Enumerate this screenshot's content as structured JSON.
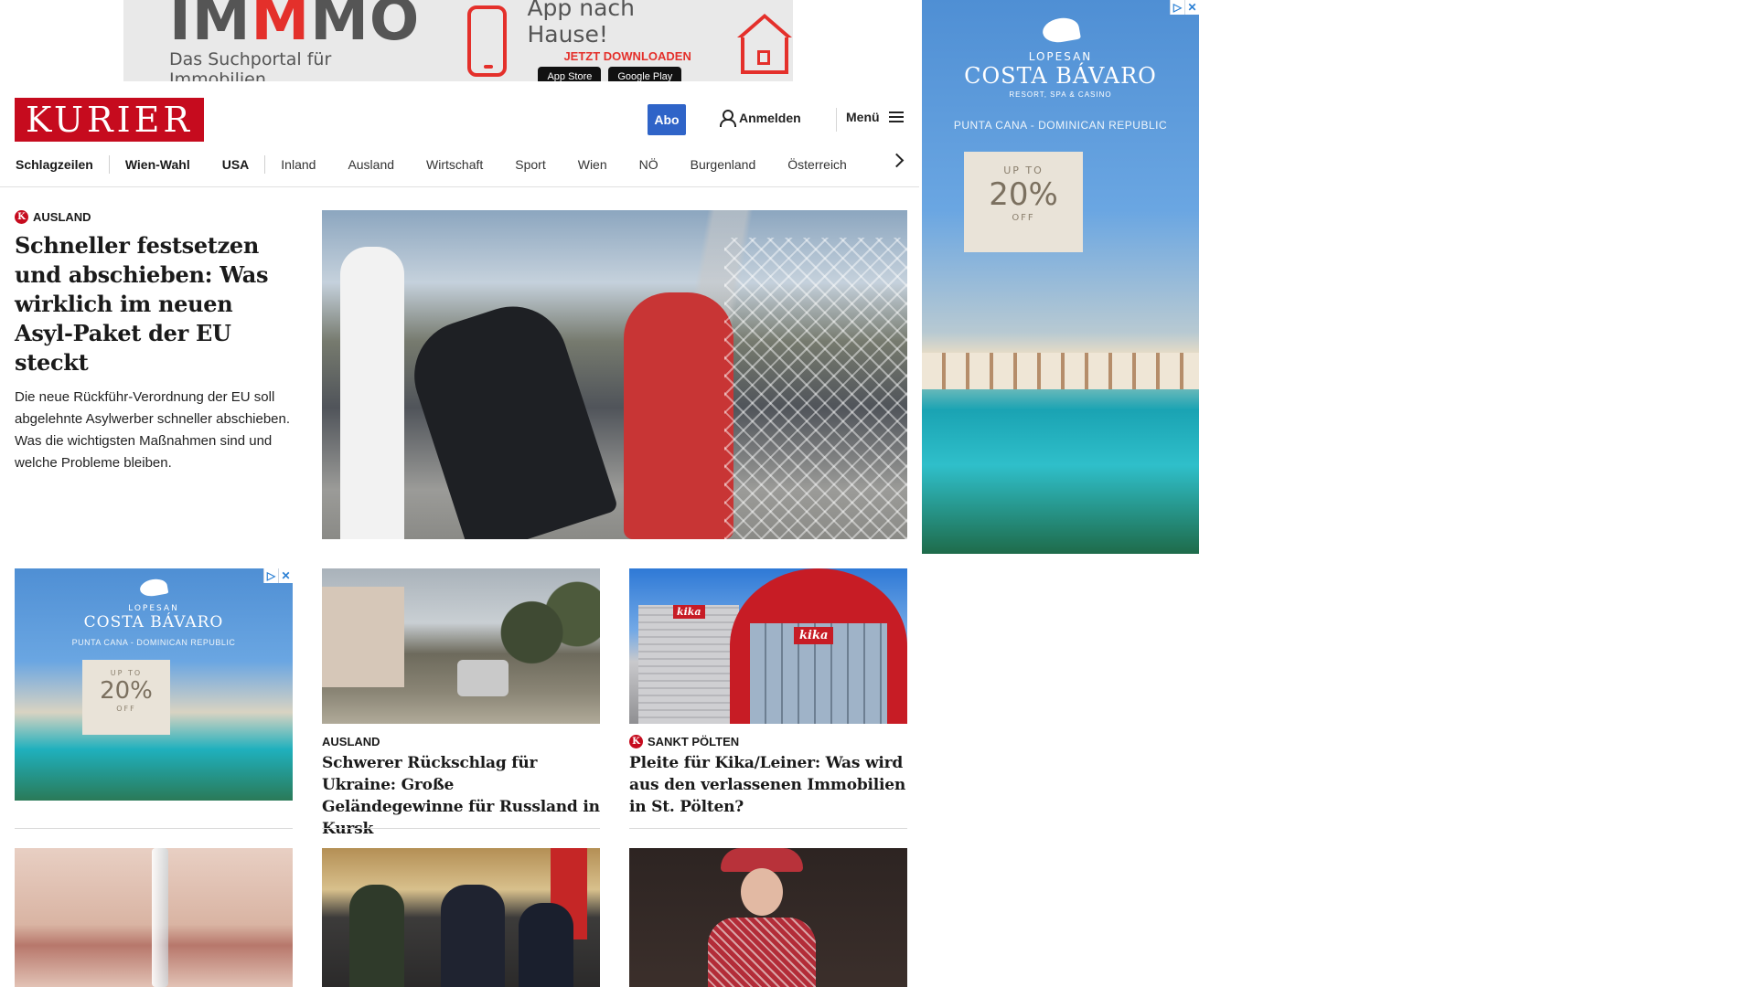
{
  "top_ad": {
    "brand_prefix": "IM",
    "brand_highlight": "M",
    "brand_suffix": "MO",
    "tagline": "Das Suchportal für Immobilien",
    "app_title": "App nach Hause!",
    "cta": "JETZT DOWNLOADEN",
    "store_apple": "App Store",
    "store_google": "Google Play",
    "accent_color": "#e4302b"
  },
  "header": {
    "logo": "KURIER",
    "abo_label": "Abo",
    "login_label": "Anmelden",
    "menu_label": "Menü",
    "brand_color": "#c60b1e",
    "abo_color": "#2f64c8"
  },
  "nav": {
    "items": [
      "Schlagzeilen",
      "Wien-Wahl",
      "USA",
      "Inland",
      "Ausland",
      "Wirtschaft",
      "Sport",
      "Wien",
      "NÖ",
      "Burgenland",
      "Österreich"
    ]
  },
  "lead": {
    "kicker": "AUSLAND",
    "title": "Schneller festsetzen und abschieben: Was wirklich im neuen Asyl-Paket der EU steckt",
    "teaser": "Die neue Rückführ-Verordnung der EU soll abgelehnte Asylwerber schneller abschieben. Was die wichtigsten Maßnahmen sind und welche Probleme bleiben."
  },
  "sky_ad": {
    "brand_small": "LOPESAN",
    "brand_name": "COSTA BÁVARO",
    "brand_tag": "RESORT, SPA & CASINO",
    "location": "PUNTA CANA - DOMINICAN REPUBLIC",
    "promo_upto": "UP TO",
    "promo_pct": "20%",
    "promo_off": "OFF"
  },
  "cards": [
    {
      "kicker": "AUSLAND",
      "title": "Schwerer Rückschlag für Ukraine: Große Geländegewinne für Russland in Kursk"
    },
    {
      "kicker": "SANKT PÖLTEN",
      "title": "Pleite für Kika/Leiner: Was wird aus den verlassenen Immobilien in St. Pölten?"
    }
  ],
  "kika_sign": "kika",
  "k_badge": "K",
  "adchoice_icons": [
    "▷",
    "✕"
  ]
}
